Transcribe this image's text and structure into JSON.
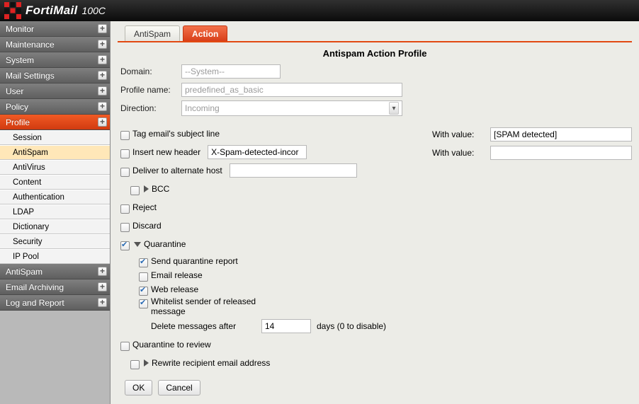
{
  "topbar": {
    "brand": "FortiMail",
    "model": "100C"
  },
  "sidebar": {
    "groups": [
      {
        "label": "Monitor",
        "expanded": false
      },
      {
        "label": "Maintenance",
        "expanded": false
      },
      {
        "label": "System",
        "expanded": false
      },
      {
        "label": "Mail Settings",
        "expanded": false
      },
      {
        "label": "User",
        "expanded": false
      },
      {
        "label": "Policy",
        "expanded": false
      },
      {
        "label": "Profile",
        "expanded": true,
        "items": [
          "Session",
          "AntiSpam",
          "AntiVirus",
          "Content",
          "Authentication",
          "LDAP",
          "Dictionary",
          "Security",
          "IP Pool"
        ],
        "selected": "AntiSpam"
      },
      {
        "label": "AntiSpam",
        "expanded": false
      },
      {
        "label": "Email Archiving",
        "expanded": false
      },
      {
        "label": "Log and Report",
        "expanded": false
      }
    ]
  },
  "tabs": {
    "items": [
      "AntiSpam",
      "Action"
    ],
    "active": "Action"
  },
  "panel": {
    "title": "Antispam Action Profile",
    "domain_label": "Domain:",
    "domain_value": "--System--",
    "profile_label": "Profile name:",
    "profile_value": "predefined_as_basic",
    "direction_label": "Direction:",
    "direction_value": "Incoming",
    "tag_subject": {
      "checked": false,
      "label": "Tag email's subject line",
      "with_label": "With value:",
      "with_value": "[SPAM detected]"
    },
    "insert_header": {
      "checked": false,
      "label": "Insert new header",
      "header_name": "X-Spam-detected-incor",
      "with_label": "With value:",
      "with_value": ""
    },
    "deliver_alt_host": {
      "checked": false,
      "label": "Deliver to alternate host",
      "value": ""
    },
    "bcc": {
      "checked": false,
      "label": "BCC"
    },
    "reject": {
      "checked": false,
      "label": "Reject"
    },
    "discard": {
      "checked": false,
      "label": "Discard"
    },
    "quarantine": {
      "checked": true,
      "label": "Quarantine",
      "send_report": {
        "checked": true,
        "label": "Send quarantine report"
      },
      "email_release": {
        "checked": false,
        "label": "Email release"
      },
      "web_release": {
        "checked": true,
        "label": "Web release"
      },
      "whitelist": {
        "checked": true,
        "label": "Whitelist sender of released message"
      },
      "delete_after_label": "Delete messages after",
      "delete_after_value": "14",
      "delete_after_suffix": "days (0 to disable)"
    },
    "quarantine_review": {
      "checked": false,
      "label": "Quarantine to review"
    },
    "rewrite_recipient": {
      "checked": false,
      "label": "Rewrite recipient email address"
    },
    "buttons": {
      "ok": "OK",
      "cancel": "Cancel"
    }
  }
}
